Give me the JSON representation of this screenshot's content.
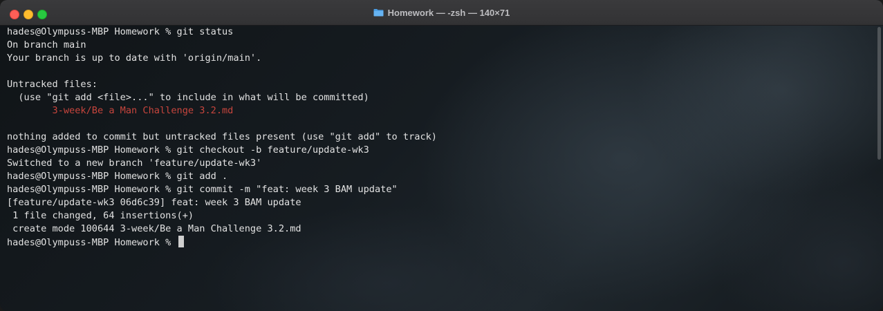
{
  "window": {
    "title": "Homework — -zsh — 140×71",
    "folder_icon": "folder-icon"
  },
  "terminal": {
    "lines": [
      {
        "text": "hades@Olympuss-MBP Homework % git status",
        "style": "normal"
      },
      {
        "text": "On branch main",
        "style": "normal"
      },
      {
        "text": "Your branch is up to date with 'origin/main'.",
        "style": "normal"
      },
      {
        "text": "",
        "style": "normal"
      },
      {
        "text": "Untracked files:",
        "style": "normal"
      },
      {
        "text": "  (use \"git add <file>...\" to include in what will be committed)",
        "style": "normal"
      },
      {
        "text": "        3-week/Be a Man Challenge 3.2.md",
        "style": "untracked"
      },
      {
        "text": "",
        "style": "normal"
      },
      {
        "text": "nothing added to commit but untracked files present (use \"git add\" to track)",
        "style": "normal"
      },
      {
        "text": "hades@Olympuss-MBP Homework % git checkout -b feature/update-wk3",
        "style": "normal"
      },
      {
        "text": "Switched to a new branch 'feature/update-wk3'",
        "style": "normal"
      },
      {
        "text": "hades@Olympuss-MBP Homework % git add .",
        "style": "normal"
      },
      {
        "text": "hades@Olympuss-MBP Homework % git commit -m \"feat: week 3 BAM update\"",
        "style": "normal"
      },
      {
        "text": "[feature/update-wk3 06d6c39] feat: week 3 BAM update",
        "style": "normal"
      },
      {
        "text": " 1 file changed, 64 insertions(+)",
        "style": "normal"
      },
      {
        "text": " create mode 100644 3-week/Be a Man Challenge 3.2.md",
        "style": "normal"
      }
    ],
    "prompt": "hades@Olympuss-MBP Homework % "
  },
  "colors": {
    "untracked": "#c7453d",
    "text": "#e2e2e2",
    "close": "#ff5f57",
    "minimize": "#febc2e",
    "zoom": "#28c840"
  }
}
